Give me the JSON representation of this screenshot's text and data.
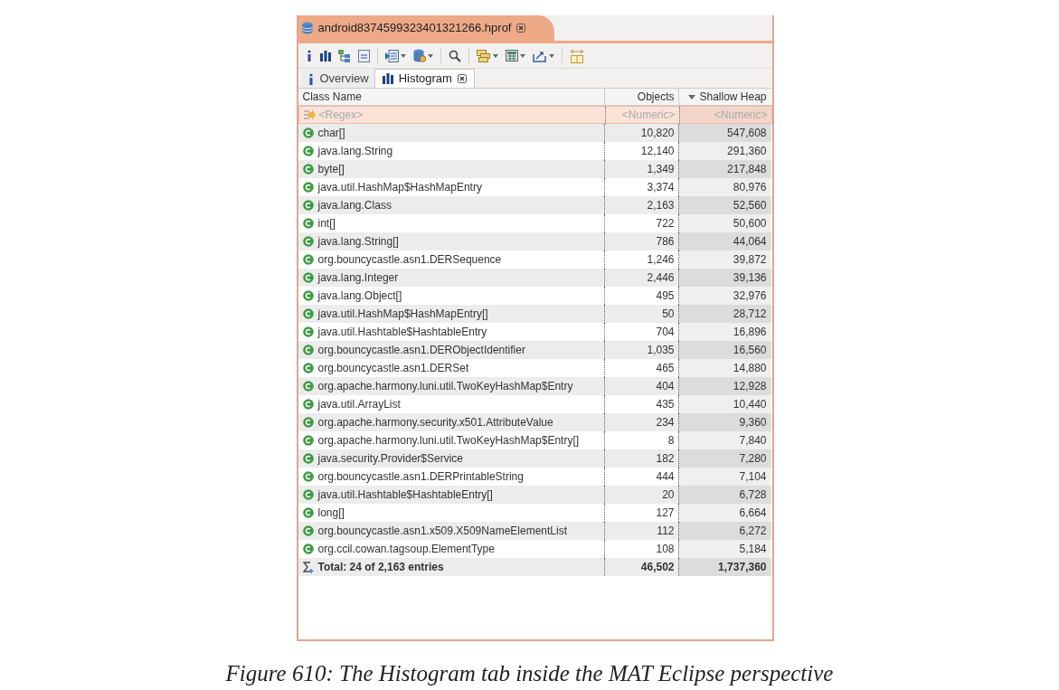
{
  "editor_tab": {
    "title": "android8374599323401321266.hprof",
    "closable": true
  },
  "toolbar": [
    [
      {
        "kind": "info",
        "dropdown": false
      },
      {
        "kind": "bars",
        "dropdown": false
      },
      {
        "kind": "tree",
        "dropdown": false
      },
      {
        "kind": "oql",
        "dropdown": false
      }
    ],
    [
      {
        "kind": "list",
        "dropdown": true
      },
      {
        "kind": "database",
        "dropdown": true
      }
    ],
    [
      {
        "kind": "search",
        "dropdown": false
      }
    ],
    [
      {
        "kind": "group",
        "dropdown": true
      },
      {
        "kind": "calculator",
        "dropdown": true
      },
      {
        "kind": "export",
        "dropdown": true
      }
    ],
    [
      {
        "kind": "columns",
        "dropdown": false
      }
    ]
  ],
  "tabs": [
    {
      "label": "Overview",
      "kind": "info",
      "selected": false,
      "closable": false
    },
    {
      "label": "Histogram",
      "kind": "bars",
      "selected": true,
      "closable": true
    }
  ],
  "table": {
    "columns": [
      {
        "label": "Class Name",
        "sorted": false
      },
      {
        "label": "Objects",
        "sorted": false
      },
      {
        "label": "Shallow Heap",
        "sorted": true
      }
    ],
    "filter_row": [
      "<Regex>",
      "<Numeric>",
      "<Numeric>"
    ],
    "rows": [
      {
        "name": "char[]",
        "objects": "10,820",
        "shallow_heap": "547,608"
      },
      {
        "name": "java.lang.String",
        "objects": "12,140",
        "shallow_heap": "291,360"
      },
      {
        "name": "byte[]",
        "objects": "1,349",
        "shallow_heap": "217,848"
      },
      {
        "name": "java.util.HashMap$HashMapEntry",
        "objects": "3,374",
        "shallow_heap": "80,976"
      },
      {
        "name": "java.lang.Class",
        "objects": "2,163",
        "shallow_heap": "52,560"
      },
      {
        "name": "int[]",
        "objects": "722",
        "shallow_heap": "50,600"
      },
      {
        "name": "java.lang.String[]",
        "objects": "786",
        "shallow_heap": "44,064"
      },
      {
        "name": "org.bouncycastle.asn1.DERSequence",
        "objects": "1,246",
        "shallow_heap": "39,872"
      },
      {
        "name": "java.lang.Integer",
        "objects": "2,446",
        "shallow_heap": "39,136"
      },
      {
        "name": "java.lang.Object[]",
        "objects": "495",
        "shallow_heap": "32,976"
      },
      {
        "name": "java.util.HashMap$HashMapEntry[]",
        "objects": "50",
        "shallow_heap": "28,712"
      },
      {
        "name": "java.util.Hashtable$HashtableEntry",
        "objects": "704",
        "shallow_heap": "16,896"
      },
      {
        "name": "org.bouncycastle.asn1.DERObjectIdentifier",
        "objects": "1,035",
        "shallow_heap": "16,560"
      },
      {
        "name": "org.bouncycastle.asn1.DERSet",
        "objects": "465",
        "shallow_heap": "14,880"
      },
      {
        "name": "org.apache.harmony.luni.util.TwoKeyHashMap$Entry",
        "objects": "404",
        "shallow_heap": "12,928"
      },
      {
        "name": "java.util.ArrayList",
        "objects": "435",
        "shallow_heap": "10,440"
      },
      {
        "name": "org.apache.harmony.security.x501.AttributeValue",
        "objects": "234",
        "shallow_heap": "9,360"
      },
      {
        "name": "org.apache.harmony.luni.util.TwoKeyHashMap$Entry[]",
        "objects": "8",
        "shallow_heap": "7,840"
      },
      {
        "name": "java.security.Provider$Service",
        "objects": "182",
        "shallow_heap": "7,280"
      },
      {
        "name": "org.bouncycastle.asn1.DERPrintableString",
        "objects": "444",
        "shallow_heap": "7,104"
      },
      {
        "name": "java.util.Hashtable$HashtableEntry[]",
        "objects": "20",
        "shallow_heap": "6,728"
      },
      {
        "name": "long[]",
        "objects": "127",
        "shallow_heap": "6,664"
      },
      {
        "name": "org.bouncycastle.asn1.x509.X509NameElementList",
        "objects": "112",
        "shallow_heap": "6,272"
      },
      {
        "name": "org.ccil.cowan.tagsoup.ElementType",
        "objects": "108",
        "shallow_heap": "5,184"
      }
    ],
    "total": {
      "label": "Total: 24 of 2,163 entries",
      "objects": "46,502",
      "shallow_heap": "1,737,360"
    }
  },
  "caption": "Figure 610: The Histogram tab inside the MAT Eclipse perspective"
}
